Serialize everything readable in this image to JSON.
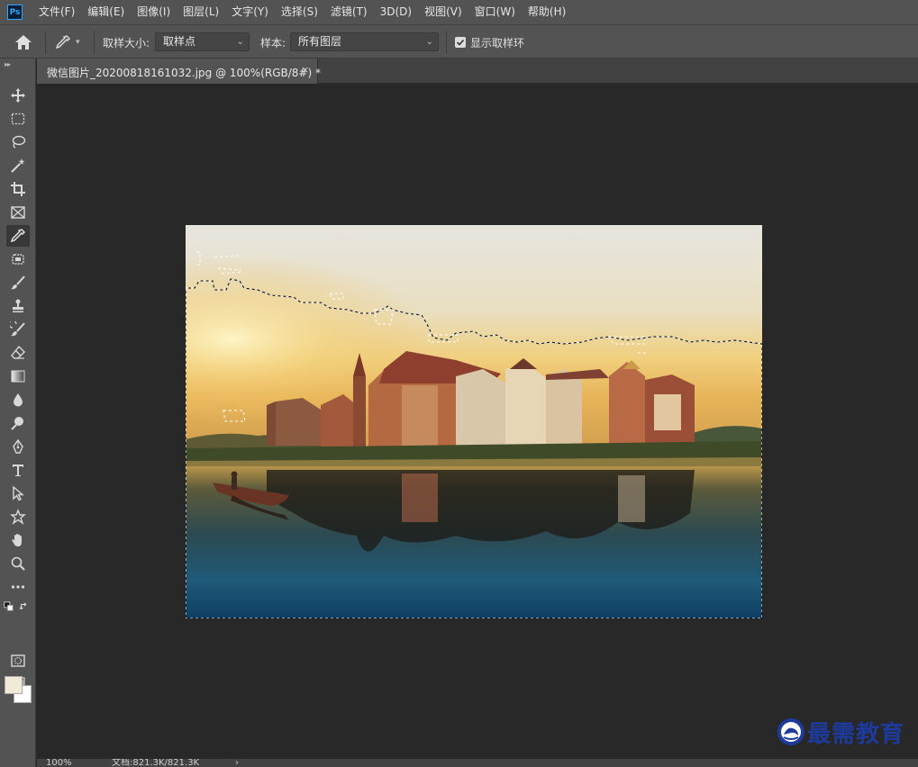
{
  "app": {
    "logo_text": "Ps"
  },
  "menu": {
    "items": [
      "文件(F)",
      "编辑(E)",
      "图像(I)",
      "图层(L)",
      "文字(Y)",
      "选择(S)",
      "滤镜(T)",
      "3D(D)",
      "视图(V)",
      "窗口(W)",
      "帮助(H)"
    ]
  },
  "options": {
    "sample_size_label": "取样大小:",
    "sample_size_value": "取样点",
    "sample_label": "样本:",
    "sample_value": "所有图层",
    "show_ring_label": "显示取样环",
    "show_ring_checked": true
  },
  "document": {
    "tab_title": "微信图片_20200818161032.jpg @ 100%(RGB/8#) *",
    "close_glyph": "×"
  },
  "toolbar": {
    "tools": [
      "move-tool",
      "marquee-tool",
      "lasso-tool",
      "magic-wand-tool",
      "crop-tool",
      "frame-tool",
      "eyedropper-tool",
      "patch-tool",
      "brush-tool",
      "clone-stamp-tool",
      "history-brush-tool",
      "eraser-tool",
      "gradient-tool",
      "blur-tool",
      "dodge-tool",
      "pen-tool",
      "type-tool",
      "path-selection-tool",
      "shape-tool",
      "hand-tool",
      "zoom-tool",
      "more-tools"
    ],
    "active_tool": "eyedropper-tool",
    "foreground_color": "#f2ead9",
    "background_color": "#ffffff"
  },
  "status": {
    "zoom": "100%",
    "doc_info": "文档:821.3K/821.3K",
    "arrow": "›"
  },
  "watermark": {
    "text": "最需教育"
  },
  "colors": {
    "accent": "#31a8ff",
    "panel": "#535353",
    "canvas_bg": "#282828",
    "watermark": "#1e3a9a"
  }
}
